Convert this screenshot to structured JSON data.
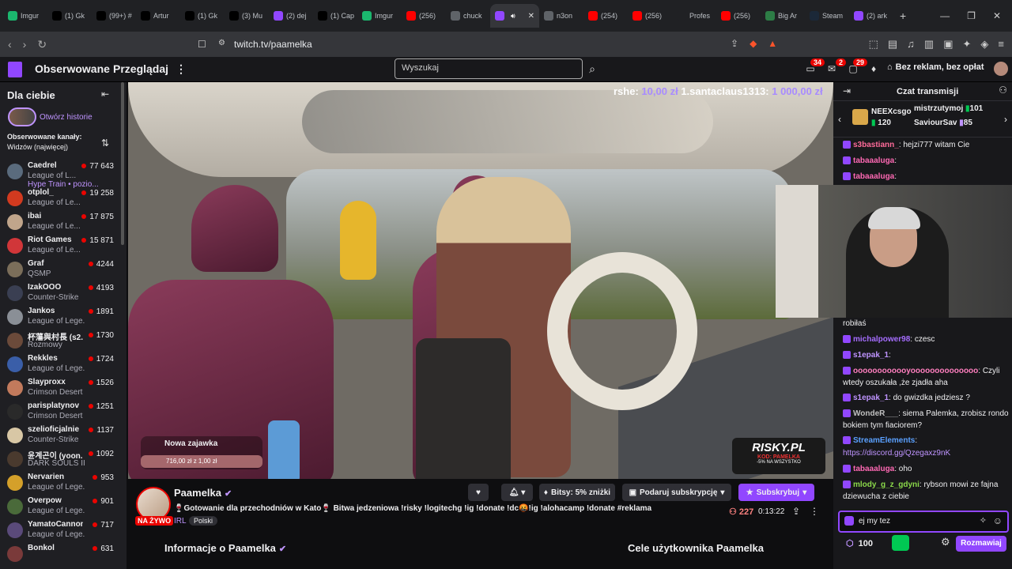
{
  "browser": {
    "tabs": [
      {
        "label": "Imgur",
        "color": "#1bb76e"
      },
      {
        "label": "(1) Gk",
        "color": "#000000"
      },
      {
        "label": "(99+) #",
        "color": "#000000"
      },
      {
        "label": "Artur",
        "color": "#000000"
      },
      {
        "label": "(1) Gk",
        "color": "#000000"
      },
      {
        "label": "(3) Mu",
        "color": "#000000"
      },
      {
        "label": "(2) dej",
        "color": "#9147ff"
      },
      {
        "label": "(1) Cap",
        "color": "#000000"
      },
      {
        "label": "Imgur",
        "color": "#1bb76e"
      },
      {
        "label": "(256)",
        "color": "#ff0000"
      },
      {
        "label": "chuck",
        "color": "#5f6368"
      },
      {
        "label": "",
        "color": "#9147ff",
        "active": true
      },
      {
        "label": "n3on",
        "color": "#5f6368"
      },
      {
        "label": "(254)",
        "color": "#ff0000"
      },
      {
        "label": "(256)",
        "color": "#ff0000"
      },
      {
        "label": "Profes",
        "color": "#202124"
      },
      {
        "label": "(256)",
        "color": "#ff0000"
      },
      {
        "label": "Big Ar",
        "color": "#2d7d46"
      },
      {
        "label": "Steam",
        "color": "#1b2838"
      },
      {
        "label": "(2) ark",
        "color": "#9147ff"
      }
    ],
    "url": "twitch.tv/paamelka"
  },
  "twitch": {
    "following": "Obserwowane",
    "browse": "Przeglądaj",
    "search_placeholder": "Wyszukaj",
    "badges": {
      "inbox": "34",
      "notif": "2",
      "whispers": "29"
    },
    "adfree": "Bez reklam, bez opłat"
  },
  "sidebar": {
    "title": "Dla ciebie",
    "stories": "Otwórz historie",
    "followed_label": "Obserwowane kanały:",
    "sort_label": "Widzów (najwięcej)",
    "channels": [
      {
        "name": "Caedrel",
        "game": "League of L...",
        "viewers": "77 643",
        "color": "#5a6b7d"
      },
      {
        "name": "otplol_",
        "game": "League of Le...",
        "viewers": "19 258",
        "color": "#d23a1f"
      },
      {
        "name": "ibai",
        "game": "League of Le...",
        "viewers": "17 875",
        "color": "#c0a58b"
      },
      {
        "name": "Riot Games",
        "game": "League of Le...",
        "viewers": "15 871",
        "color": "#d13639"
      },
      {
        "name": "Graf",
        "game": "QSMP",
        "viewers": "4244",
        "color": "#7b6e5a"
      },
      {
        "name": "IzakOOO",
        "game": "Counter-Strike",
        "viewers": "4193",
        "color": "#3a3f52"
      },
      {
        "name": "Jankos",
        "game": "League of Lege...",
        "viewers": "1891",
        "color": "#8a8f96"
      },
      {
        "name": "杯藩與村長 (s2...",
        "game": "Rozmowy",
        "viewers": "1730",
        "color": "#6b4a3a"
      },
      {
        "name": "Rekkles",
        "game": "League of Lege...",
        "viewers": "1724",
        "color": "#3a5ea8"
      },
      {
        "name": "Slayproxx",
        "game": "Crimson Desert",
        "viewers": "1526",
        "color": "#c27a5c"
      },
      {
        "name": "parisplatynov",
        "game": "Crimson Desert",
        "viewers": "1251",
        "color": "#2a2a2a"
      },
      {
        "name": "szelioficjalnie",
        "game": "Counter-Strike",
        "viewers": "1137",
        "color": "#d8c7a5"
      },
      {
        "name": "윤계곤이 (yoon...",
        "game": "DARK SOULS III",
        "viewers": "1092",
        "color": "#4a3a2e"
      },
      {
        "name": "Nervarien",
        "game": "League of Lege...",
        "viewers": "953",
        "color": "#d4a02a"
      },
      {
        "name": "Overpow",
        "game": "League of Lege...",
        "viewers": "901",
        "color": "#4a6a3a"
      },
      {
        "name": "YamatoCannon",
        "game": "League of Lege...",
        "viewers": "717",
        "color": "#5a4a7a"
      },
      {
        "name": "Bonkol",
        "game": "",
        "viewers": "631",
        "color": "#7a3a3a"
      }
    ],
    "caedrel_hype": "Hype Train • pozio..."
  },
  "video": {
    "overlay_a": "rshe:",
    "overlay_b": "10,00 zł",
    "overlay_c": "1.santaclaus1313:",
    "overlay_d": "1 000,00 zł",
    "hype_title": "Nowa zajawka",
    "hype_value": "716,00 zł z 1,00 zł",
    "risky_logo": "RISKY.PL",
    "risky_code": "KOD: PAMELKA",
    "risky_promo": "-5% NA WSZYSTKO"
  },
  "stream": {
    "name": "Paamelka",
    "live": "NA ŻYWO",
    "title": "🍷Gotowanie dla przechodniów w Kato🍷 Bitwa jedzeniowa !risky !logitechg !ig !donate !dc🤬!ig !alohacamp !donate #reklama",
    "category": "IRL",
    "tag": "Polski",
    "bits": "Bitsy: 5% zniżki",
    "gift": "Podaruj subskrypcję",
    "subscribe": "Subskrybuj",
    "viewers": "227",
    "uptime": "0:13:22",
    "about": "Informacje o Paamelka",
    "goals": "Cele użytkownika Paamelka"
  },
  "chat": {
    "title": "Czat transmisji",
    "leaders": [
      {
        "name": "NEEXcsgo",
        "amount": "120"
      },
      {
        "name": "mistrzutymoj",
        "amount": "101"
      },
      {
        "name": "SaviourSav",
        "amount": "85"
      }
    ],
    "messages": [
      {
        "user": "s3bastiann_",
        "text": ": hejzi777 witam Cie",
        "color": "#ff6b9a"
      },
      {
        "user": "tabaaaluga",
        "text": ":",
        "color": "#ff69b4"
      },
      {
        "user": "tabaaaluga",
        "text": ":",
        "color": "#ff69b4"
      },
      {
        "user": "",
        "text": "robiłaś",
        "color": "#efeff1"
      },
      {
        "user": "michalpower98",
        "text": ": czesc",
        "color": "#a56dff"
      },
      {
        "user": "s1epak_1",
        "text": ":",
        "color": "#bf94ff"
      },
      {
        "user": "oooooooooooyoooooooooooooo",
        "text": ": Czyli wtedy oszukała ,że zjadła aha",
        "color": "#ff7fbf"
      },
      {
        "user": "s1epak_1",
        "text": ": do gwizdka jedziesz ?",
        "color": "#bf94ff"
      },
      {
        "user": "WondeR___",
        "text": ": siema Palemka, zrobisz rondo bokiem tym fiaciorem?",
        "color": "#c0c0c0"
      },
      {
        "user": "StreamElements",
        "text": ":",
        "color": "#5aa0ff"
      },
      {
        "user": "",
        "text": "https://discord.gg/Qzegaxz9nK",
        "color": "#bf94ff"
      },
      {
        "user": "tabaaaluga",
        "text": ": oho",
        "color": "#ff69b4"
      },
      {
        "user": "mlody_g_z_gdyni",
        "text": ": rybson mowi ze fajna dziewucha z ciebie",
        "color": "#8bd94a"
      }
    ],
    "input_value": "ej my tez",
    "points": "100",
    "chat_button": "Rozmawiaj"
  }
}
